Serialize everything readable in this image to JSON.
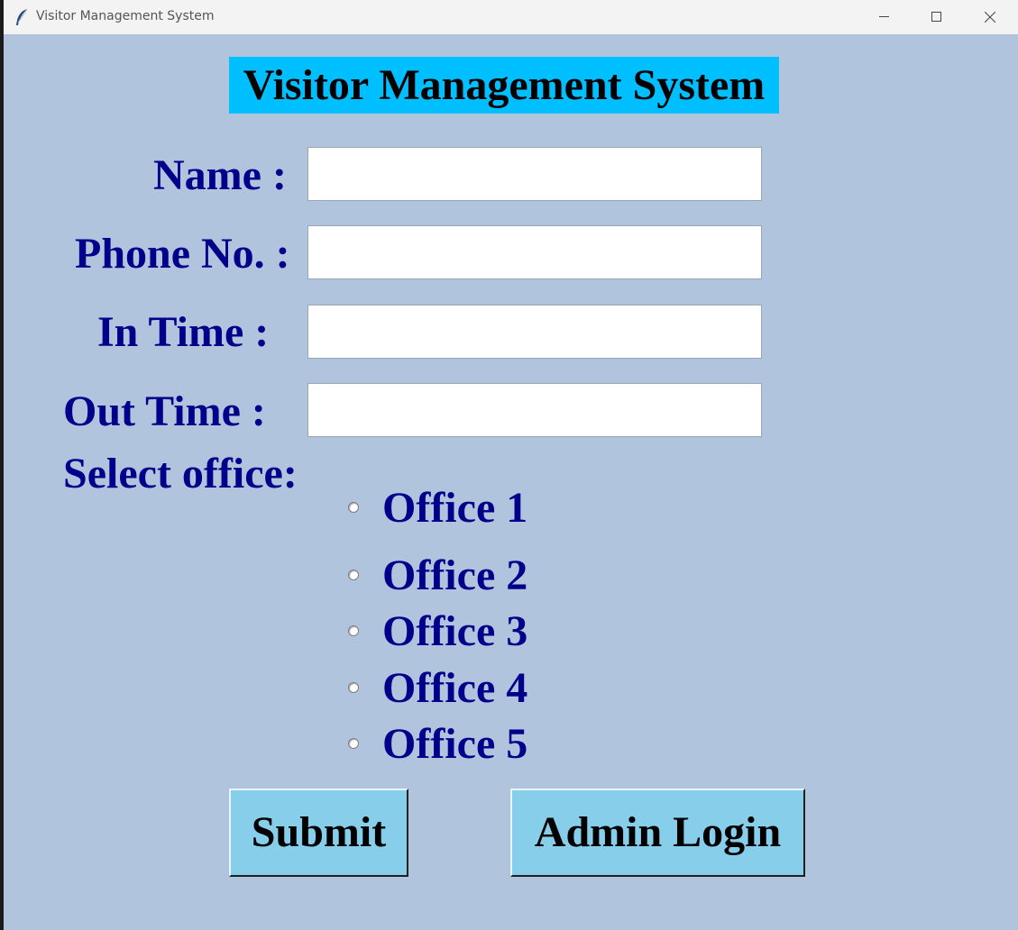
{
  "window": {
    "title": "Visitor Management System",
    "controls": [
      "minimize-icon",
      "maximize-icon",
      "close-icon"
    ]
  },
  "form": {
    "heading": "Visitor Management System",
    "fields": [
      {
        "label": "Name :",
        "value": ""
      },
      {
        "label": "Phone No. :",
        "value": ""
      },
      {
        "label": "In Time :",
        "value": ""
      },
      {
        "label": "Out Time :",
        "value": ""
      }
    ],
    "office_label": "Select office:",
    "offices": [
      "Office 1",
      "Office 2",
      "Office 3",
      "Office 4",
      "Office 5"
    ],
    "selected_office": null,
    "submit_label": "Submit",
    "admin_label": "Admin Login"
  },
  "colors": {
    "background": "#b0c4de",
    "heading_bg": "#00bfff",
    "label_text": "#00008b",
    "button_bg": "#87ceeb"
  }
}
